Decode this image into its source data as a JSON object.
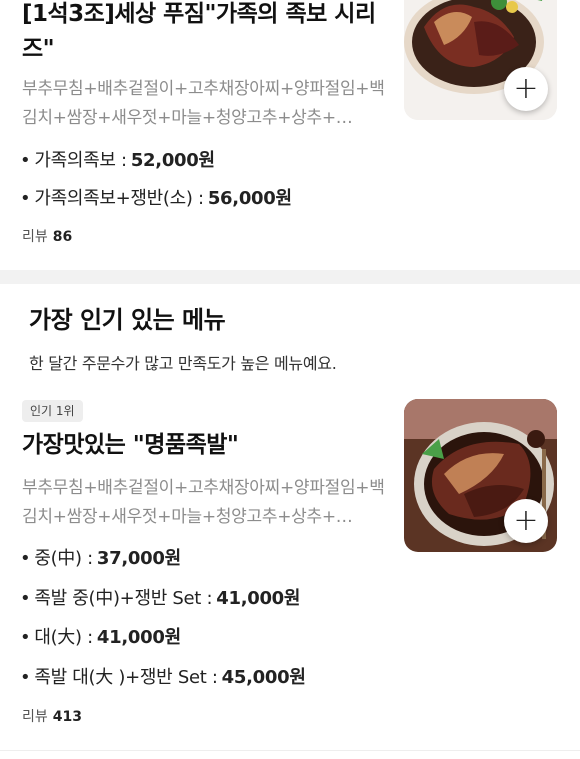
{
  "item1": {
    "name": "[1석3조]세상 푸짐\"가족의 족보 시리즈\"",
    "description": "부추무침+배추겉절이+고추채장아찌+양파절임+백김치+쌈장+새우젓+마늘+청양고추+상추+…",
    "prices": [
      {
        "label": "가족의족보 :",
        "amount": "52,000원"
      },
      {
        "label": "가족의족보+쟁반(소) :",
        "amount": "56,000원"
      }
    ],
    "review_label": "리뷰",
    "review_count": "86",
    "add_icon": "plus-icon"
  },
  "popular": {
    "title": "가장 인기 있는 메뉴",
    "subtitle": "한 달간 주문수가 많고 만족도가 높은 메뉴예요.",
    "item": {
      "badge": "인기 1위",
      "name": "가장맛있는 \"명품족발\"",
      "description": "부추무침+배추겉절이+고추채장아찌+양파절임+백김치+쌈장+새우젓+마늘+청양고추+상추+…",
      "prices": [
        {
          "label": "중(中) :",
          "amount": "37,000원"
        },
        {
          "label": "족발 중(中)+쟁반 Set :",
          "amount": "41,000원"
        },
        {
          "label": "대(大) :",
          "amount": "41,000원"
        },
        {
          "label": "족발 대(大 )+쟁반 Set :",
          "amount": "45,000원"
        }
      ],
      "review_label": "리뷰",
      "review_count": "413",
      "add_icon": "plus-icon"
    }
  },
  "colors": {
    "divider": "#f2f2f2",
    "muted_text": "#8c8c8c",
    "badge_bg": "#eeeeee"
  }
}
